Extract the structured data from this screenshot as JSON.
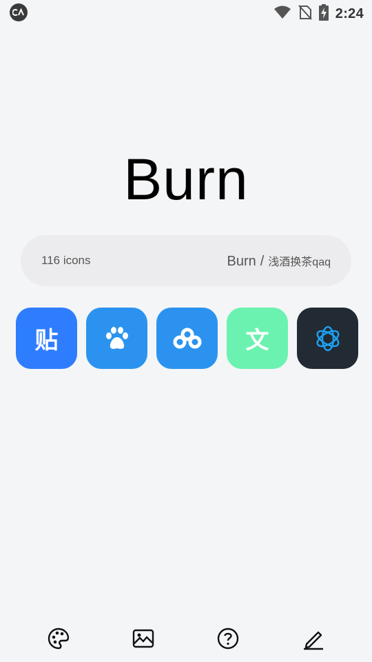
{
  "status_bar": {
    "time": "2:24",
    "left_icon": "app-notification-icon",
    "icons": [
      "wifi-icon",
      "no-sim-icon",
      "battery-charging-icon"
    ]
  },
  "header": {
    "title": "Burn"
  },
  "info": {
    "icon_count": "116 icons",
    "pack_name": "Burn",
    "separator": "/",
    "author": "浅酒换茶qaq"
  },
  "icons": [
    {
      "name": "tieba-icon",
      "glyph": "贴",
      "color": "#2f7dff"
    },
    {
      "name": "baidu-paw-icon",
      "glyph": "",
      "color": "#2b93ef"
    },
    {
      "name": "cloud-drive-icon",
      "glyph": "",
      "color": "#2b93ef"
    },
    {
      "name": "translate-wen-icon",
      "glyph": "文",
      "color": "#6bf2b0"
    },
    {
      "name": "battle-net-icon",
      "glyph": "",
      "color": "#222a33"
    }
  ],
  "bottom_nav": [
    "palette-icon",
    "image-icon",
    "help-icon",
    "edit-pencil-icon"
  ]
}
